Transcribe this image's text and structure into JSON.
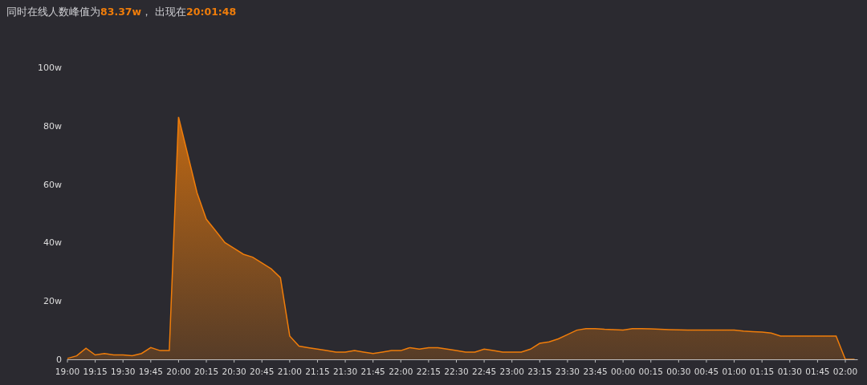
{
  "header": {
    "text": "同时在线人数峰值为**83.37w**， 出现在**20:01:48**"
  },
  "chart_data": {
    "type": "area",
    "categories": [
      "19:00",
      null,
      null,
      "19:15",
      null,
      null,
      "19:30",
      null,
      null,
      "19:45",
      null,
      null,
      "20:00",
      null,
      null,
      "20:15",
      null,
      null,
      "20:30",
      null,
      null,
      "20:45",
      null,
      null,
      "21:00",
      null,
      null,
      "21:15",
      null,
      null,
      "21:30",
      null,
      null,
      "21:45",
      null,
      null,
      "22:00",
      null,
      null,
      "22:15",
      null,
      null,
      "22:30",
      null,
      null,
      "22:45",
      null,
      null,
      "23:00",
      null,
      null,
      "23:15",
      null,
      null,
      "23:30",
      null,
      null,
      "23:45",
      null,
      null,
      "00:00",
      null,
      null,
      "00:15",
      null,
      null,
      "00:30",
      null,
      null,
      "00:45",
      null,
      null,
      "01:00",
      null,
      null,
      "01:15",
      null,
      null,
      "01:30",
      null,
      null,
      "01:45",
      null,
      null,
      "02:00",
      null
    ],
    "series": [
      {
        "color": "#f07d0a",
        "values": [
          0.3,
          1.2,
          3.8,
          1.5,
          2,
          1.5,
          1.5,
          1.2,
          2,
          4,
          3,
          3,
          83,
          70,
          57,
          48,
          44,
          40,
          38,
          36,
          35,
          33,
          31,
          28,
          8,
          4.5,
          4,
          3.5,
          3,
          2.5,
          2.5,
          3,
          2.5,
          2,
          2.5,
          3,
          3,
          4,
          3.5,
          4,
          4,
          3.5,
          3,
          2.5,
          2.5,
          3.5,
          3,
          2.5,
          2.5,
          2.5,
          3.5,
          5.5,
          6,
          7,
          8.5,
          10,
          10.5,
          10.5,
          10.3,
          10.2,
          10,
          10.5,
          10.5,
          10.4,
          10.3,
          10.2,
          10.1,
          10,
          10,
          10,
          10,
          10,
          10,
          9.7,
          9.5,
          9.3,
          9,
          8,
          8,
          8,
          8,
          8,
          8,
          8,
          0,
          0
        ]
      }
    ],
    "ylim": [
      0,
      100
    ],
    "yticks": [
      {
        "value": 0,
        "label": "0"
      },
      {
        "value": 20,
        "label": "20w"
      },
      {
        "value": 40,
        "label": "40w"
      },
      {
        "value": 60,
        "label": "60w"
      },
      {
        "value": 80,
        "label": "80w"
      },
      {
        "value": 100,
        "label": "100w"
      }
    ]
  }
}
